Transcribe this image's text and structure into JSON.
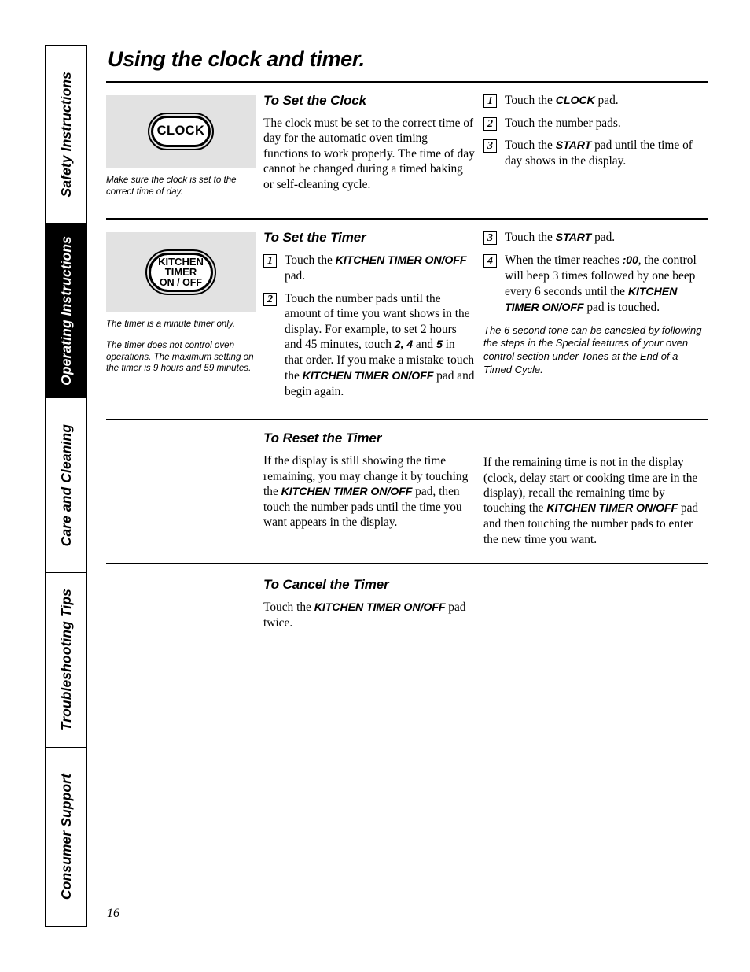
{
  "page": {
    "title": "Using the clock and timer.",
    "number": "16"
  },
  "sidebar": {
    "tabs": [
      {
        "label": "Safety Instructions",
        "active": false
      },
      {
        "label": "Operating Instructions",
        "active": true
      },
      {
        "label": "Care and Cleaning",
        "active": false
      },
      {
        "label": "Troubleshooting Tips",
        "active": false
      },
      {
        "label": "Consumer Support",
        "active": false
      }
    ]
  },
  "clock_section": {
    "pad_label": "CLOCK",
    "caption": "Make sure the clock is set to the correct time of day.",
    "heading": "To Set the Clock",
    "body": "The clock must be set to the correct time of day for the automatic oven timing functions to work properly. The time of day cannot be changed during a timed baking or self-cleaning cycle.",
    "steps": [
      {
        "num": "1",
        "pre": "Touch the ",
        "bold": "CLOCK",
        "post": " pad."
      },
      {
        "num": "2",
        "pre": "Touch the number pads.",
        "bold": "",
        "post": ""
      },
      {
        "num": "3",
        "pre": "Touch the ",
        "bold": "START",
        "post": " pad until the time of day shows in the display."
      }
    ]
  },
  "timer_section": {
    "pad_line1": "KITCHEN",
    "pad_line2": "TIMER",
    "pad_line3": "ON / OFF",
    "caption1": "The timer is a minute timer only.",
    "caption2": "The timer does not control oven operations. The maximum setting on the timer is 9 hours and 59 minutes.",
    "heading": "To Set the Timer",
    "step1": {
      "num": "1",
      "pre": "Touch the ",
      "bold": "KITCHEN TIMER ON/OFF",
      "post": " pad."
    },
    "step2": {
      "num": "2",
      "t1": "Touch the number pads until the amount of time you want shows in the display. For example, to set 2 hours and 45 minutes, touch ",
      "b1": "2, 4",
      "t2": " and ",
      "b2": "5",
      "t3": " in that order. If you make a mistake touch the ",
      "b3": "KITCHEN TIMER ON/OFF",
      "t4": " pad and begin again."
    },
    "step3": {
      "num": "3",
      "pre": "Touch the ",
      "bold": "START",
      "post": " pad."
    },
    "step4": {
      "num": "4",
      "t1": "When the timer reaches ",
      "b1": ":00",
      "t2": ", the control will beep 3 times followed by one beep every 6 seconds until the ",
      "b2": "KITCHEN TIMER ON/OFF",
      "t3": " pad is touched."
    },
    "note": "The 6 second tone can be canceled by following the steps in the Special features of your oven control section under Tones at the End of a Timed Cycle."
  },
  "reset_section": {
    "heading": "To Reset the Timer",
    "left": {
      "t1": "If the display is still showing the time remaining, you may change it by touching the ",
      "b1": "KITCHEN TIMER ON/OFF",
      "t2": " pad, then touch the number pads until the time you want appears in the display."
    },
    "right": {
      "t1": "If the remaining time is not in the display (clock, delay start or cooking time are in the display), recall the remaining time by touching the ",
      "b1": "KITCHEN TIMER ON/OFF",
      "t2": " pad and then touching the number pads to enter the new time you want."
    }
  },
  "cancel_section": {
    "heading": "To Cancel the Timer",
    "t1": "Touch the ",
    "b1": "KITCHEN TIMER ON/OFF",
    "t2": " pad twice."
  }
}
